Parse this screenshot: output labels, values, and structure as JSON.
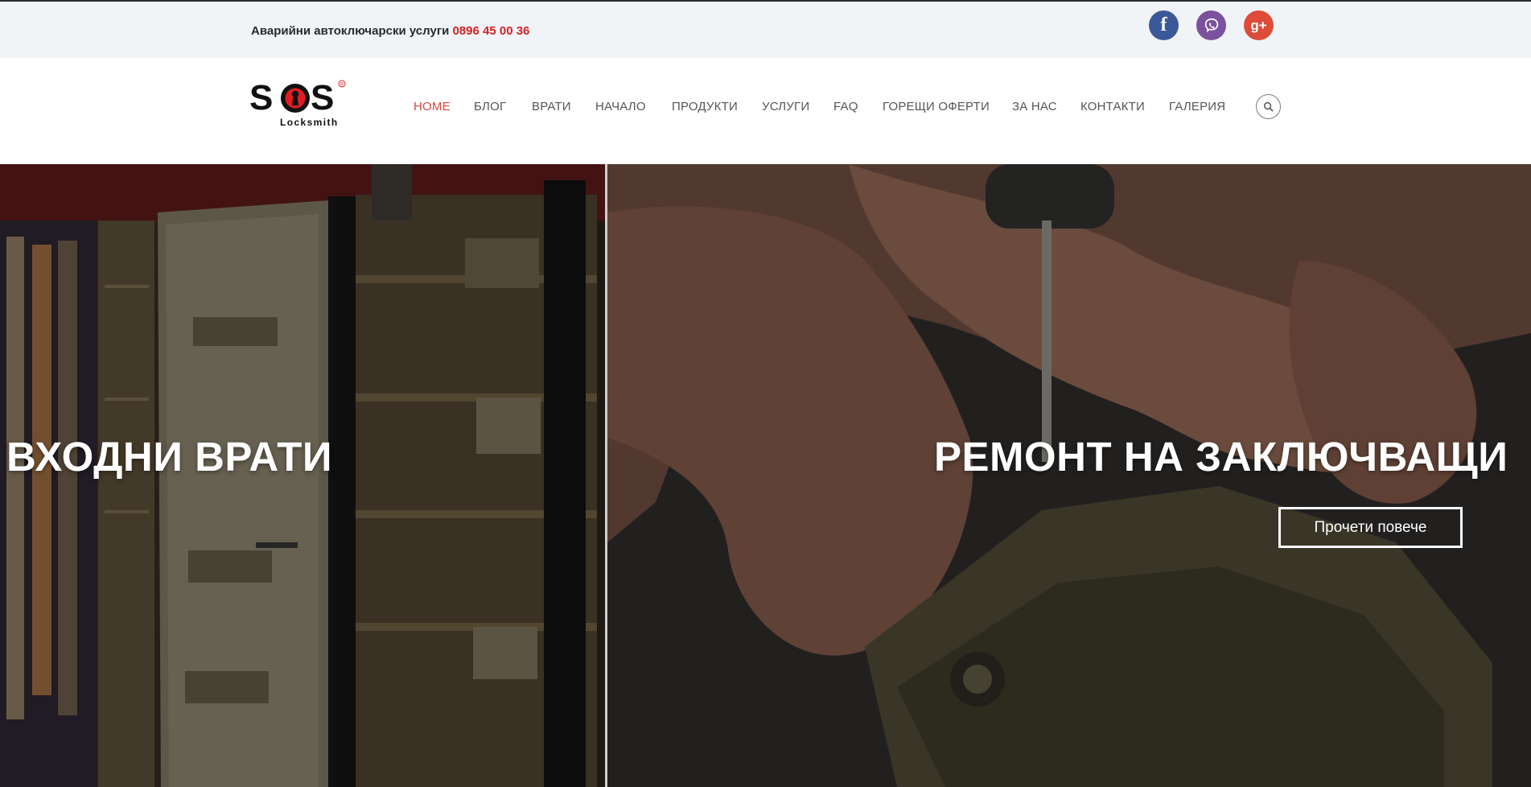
{
  "topbar": {
    "service_text": "Аварийни автоключарски услуги ",
    "phone": "0896 45 00 36",
    "social": [
      {
        "icon": "facebook-icon",
        "glyph": "f"
      },
      {
        "icon": "viber-icon",
        "glyph": ""
      },
      {
        "icon": "google-plus-icon",
        "glyph": "g+"
      }
    ]
  },
  "logo": {
    "brand": "SOS",
    "sub": "Locksmith",
    "mark": "®"
  },
  "nav": {
    "items": [
      {
        "label": "HOME",
        "active": true
      },
      {
        "label": "БЛОГ"
      },
      {
        "label": "ВРАТИ"
      },
      {
        "label": "НАЧАЛО"
      },
      {
        "label": "ПРОДУКТИ"
      },
      {
        "label": "УСЛУГИ"
      },
      {
        "label": "FAQ"
      },
      {
        "label": "ГОРЕЩИ ОФЕРТИ"
      },
      {
        "label": "ЗА НАС"
      },
      {
        "label": "КОНТАКТИ"
      },
      {
        "label": "ГАЛЕРИЯ"
      }
    ],
    "search_icon": "search-icon"
  },
  "hero": {
    "left_title": "ВХОДНИ ВРАТИ",
    "right_title": "РЕМОНТ НА ЗАКЛЮЧВАЩИ",
    "button": "Прочети повече"
  },
  "colors": {
    "accent": "#d52121",
    "nav_active": "#d9473b",
    "topbar_bg": "#f1f4f7"
  }
}
